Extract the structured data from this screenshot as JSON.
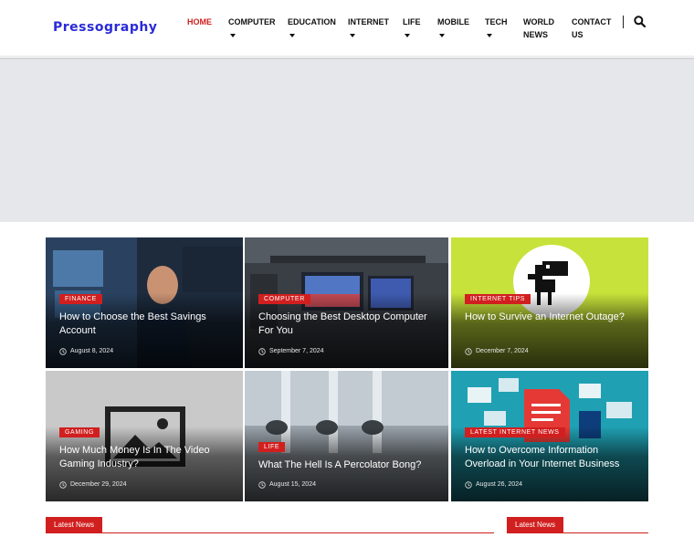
{
  "header": {
    "logo": "Pressography",
    "nav": [
      {
        "label": "HOME",
        "active": true,
        "dropdown": false
      },
      {
        "label": "COMPUTER",
        "active": false,
        "dropdown": true
      },
      {
        "label": "EDUCATION",
        "active": false,
        "dropdown": true
      },
      {
        "label": "INTERNET",
        "active": false,
        "dropdown": true
      },
      {
        "label": "LIFE",
        "active": false,
        "dropdown": true
      },
      {
        "label": "MOBILE",
        "active": false,
        "dropdown": true
      },
      {
        "label": "TECH",
        "active": false,
        "dropdown": true
      },
      {
        "label": "WORLD NEWS",
        "active": false,
        "dropdown": false
      },
      {
        "label": "CONTACT US",
        "active": false,
        "dropdown": false
      }
    ],
    "search_icon": "search-icon"
  },
  "cards": [
    {
      "category": "Finance",
      "title": "How to Choose the Best Savings Account",
      "date": "August 8, 2024",
      "image": "man-at-monitors"
    },
    {
      "category": "Computer",
      "title": "Choosing the Best Desktop Computer For You",
      "date": "September 7, 2024",
      "image": "desktop-setup"
    },
    {
      "category": "Internet Tips",
      "title": "How to Survive an Internet Outage?",
      "date": "December 7, 2024",
      "image": "dino-no-internet"
    },
    {
      "category": "Gaming",
      "title": "How Much Money Is In The Video Gaming Industry?",
      "date": "December 29, 2024",
      "image": "placeholder-image"
    },
    {
      "category": "Life",
      "title": "What The Hell Is A Percolator Bong?",
      "date": "August 15, 2024",
      "image": "glass-bongs"
    },
    {
      "category": "Latest Internet News",
      "title": "How to Overcome Information Overload in Your Internet Business",
      "date": "August 26, 2024",
      "image": "email-overload"
    }
  ],
  "sections": [
    {
      "label": "Latest News"
    },
    {
      "label": "Latest News"
    }
  ],
  "colors": {
    "accent": "#d11f1f",
    "logo": "#2a2ad8",
    "banner": "#e6e7eb"
  }
}
